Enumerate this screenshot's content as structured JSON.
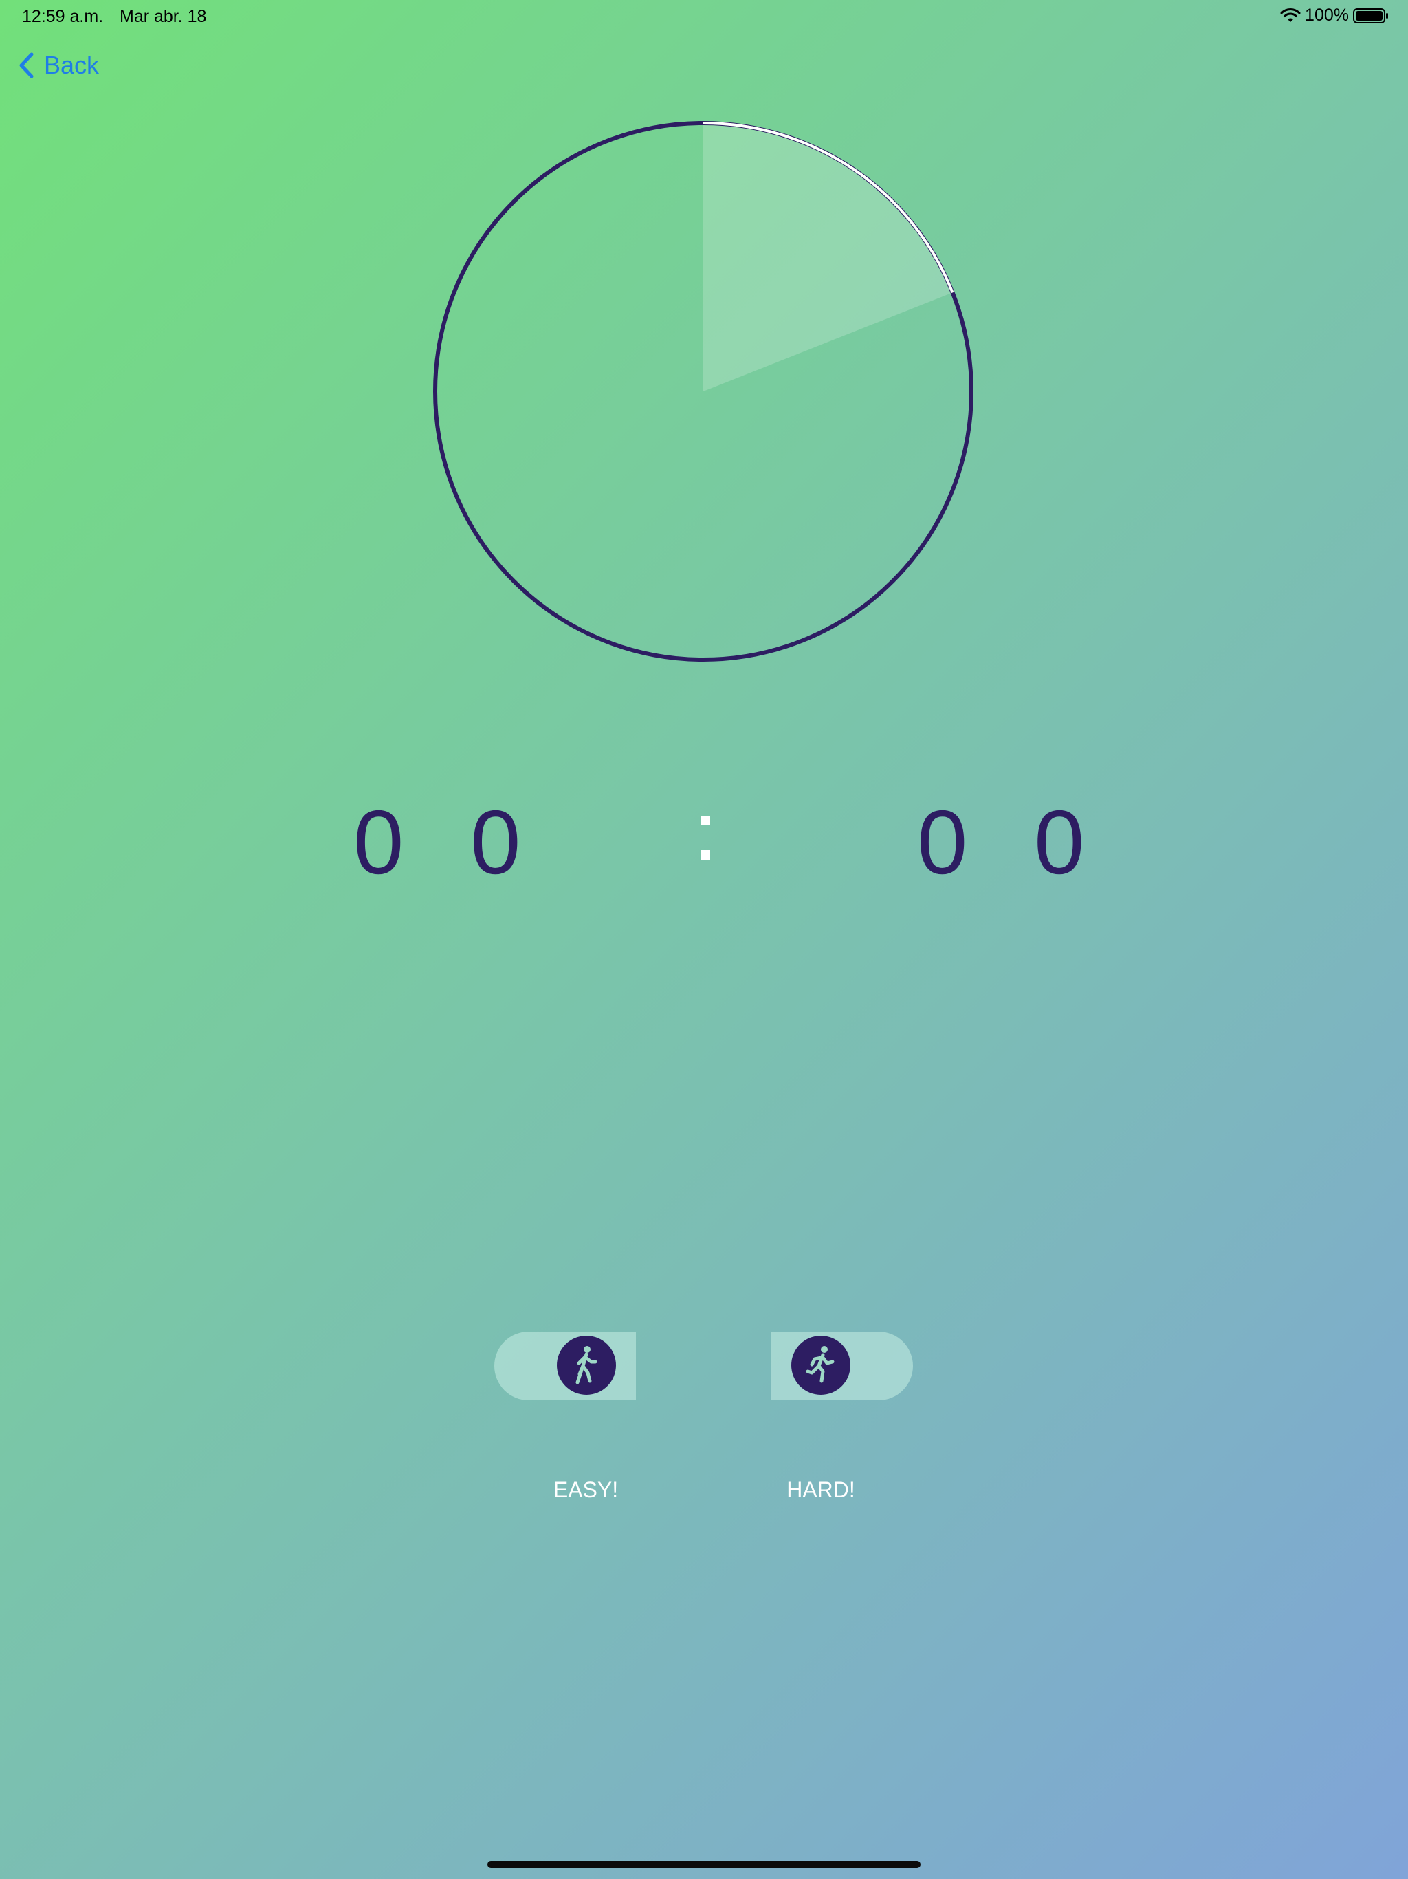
{
  "status_bar": {
    "time": "12:59 a.m.",
    "date": "Mar abr. 18",
    "battery": "100%",
    "wifi_icon": "wifi-icon",
    "battery_icon": "battery-icon"
  },
  "nav": {
    "back_label": "Back",
    "back_icon": "chevron-left-icon"
  },
  "timer": {
    "progress_fraction": 0.19,
    "minutes": "0 0",
    "seconds": "0 0"
  },
  "modes": [
    {
      "label": "EASY!",
      "icon": "walking-person-icon"
    },
    {
      "label": "HARD!",
      "icon": "running-person-icon"
    }
  ],
  "colors": {
    "accent": "#2d1d62",
    "back_link": "#1f7ee6",
    "ring_highlight": "#ffffff"
  }
}
